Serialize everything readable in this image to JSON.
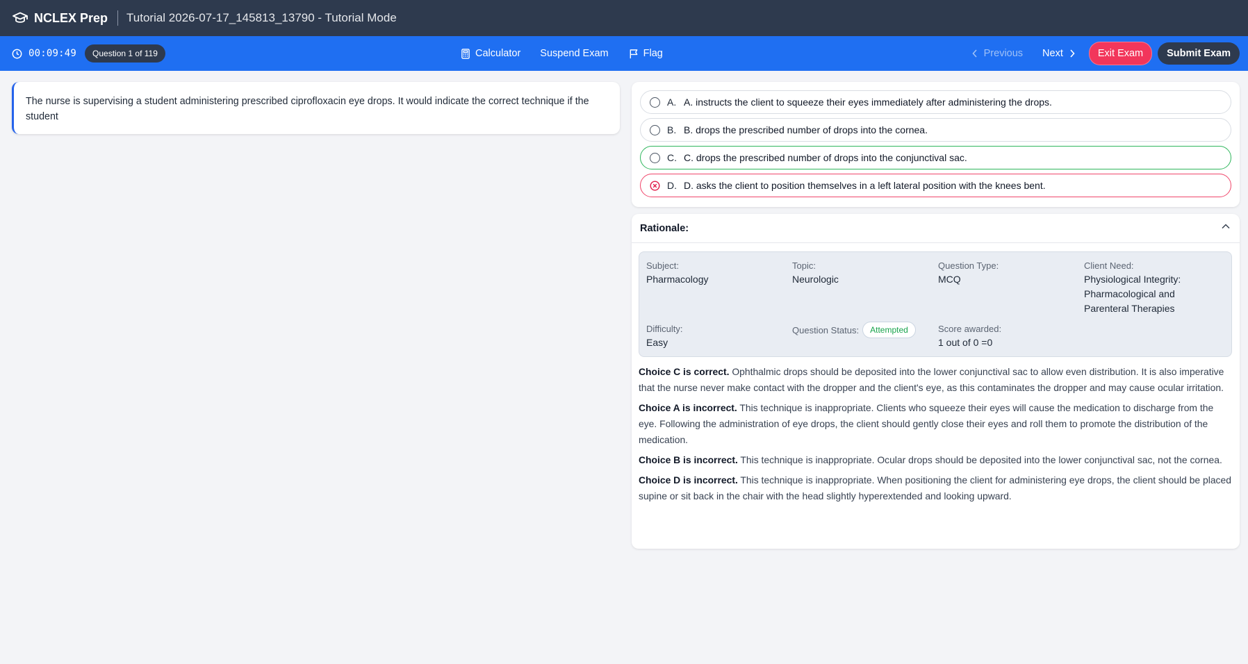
{
  "header": {
    "app_title": "NCLEX Prep",
    "exam_title": "Tutorial 2026-07-17_145813_13790 - Tutorial Mode"
  },
  "toolbar": {
    "timer": "00:09:49",
    "question_counter": "Question 1 of 119",
    "calculator_label": "Calculator",
    "suspend_label": "Suspend Exam",
    "flag_label": "Flag",
    "previous_label": "Previous",
    "next_label": "Next",
    "exit_label": "Exit Exam",
    "submit_label": "Submit Exam"
  },
  "question": {
    "text": "The nurse is supervising a student administering prescribed ciprofloxacin eye drops. It would indicate the correct technique if the student"
  },
  "options": [
    {
      "letter": "A.",
      "text": "A. instructs the client to squeeze their eyes immediately after administering the drops.",
      "state": "none"
    },
    {
      "letter": "B.",
      "text": "B. drops the prescribed number of drops into the cornea.",
      "state": "none"
    },
    {
      "letter": "C.",
      "text": "C. drops the prescribed number of drops into the conjunctival sac.",
      "state": "correct"
    },
    {
      "letter": "D.",
      "text": "D. asks the client to position themselves in a left lateral position with the knees bent.",
      "state": "selected-wrong"
    }
  ],
  "rationale": {
    "title": "Rationale:",
    "subject_label": "Subject:",
    "subject_value": "Pharmacology",
    "topic_label": "Topic:",
    "topic_value": "Neurologic",
    "qtype_label": "Question Type:",
    "qtype_value": "MCQ",
    "client_need_label": "Client Need:",
    "client_need_value": "Physiological Integrity: Pharmacological and Parenteral Therapies",
    "difficulty_label": "Difficulty:",
    "difficulty_value": "Easy",
    "status_label": "Question Status:",
    "status_value": "Attempted",
    "score_label": "Score awarded:",
    "score_value": "1 out of 0 =0",
    "explanations": [
      {
        "lead": "Choice C is correct.",
        "body": " Ophthalmic drops should be deposited into the lower conjunctival sac to allow even distribution. It is also imperative that the nurse never make contact with the dropper and the client's eye, as this contaminates the dropper and may cause ocular irritation."
      },
      {
        "lead": "Choice A is incorrect.",
        "body": " This technique is inappropriate. Clients who squeeze their eyes will cause the medication to discharge from the eye. Following the administration of eye drops, the client should gently close their eyes and roll them to promote the distribution of the medication."
      },
      {
        "lead": "Choice B is incorrect.",
        "body": " This technique is inappropriate. Ocular drops should be deposited into the lower conjunctival sac, not the cornea."
      },
      {
        "lead": "Choice D is incorrect.",
        "body": " This technique is inappropriate. When positioning the client for administering eye drops, the client should be placed supine or sit back in the chair with the head slightly hyperextended and looking upward."
      }
    ]
  },
  "colors": {
    "header_bg": "#2e3a4e",
    "toolbar_bg": "#1f6ff2",
    "exit_bg": "#f2365b",
    "correct_border": "#2fb65c",
    "wrong_border": "#f0456a",
    "attempted_text": "#16a34a"
  },
  "icons": {
    "logo": "graduation-cap-icon",
    "timer": "clock-icon",
    "calculator": "calculator-icon",
    "flag": "flag-icon",
    "previous": "chevron-left-icon",
    "next": "chevron-right-icon",
    "rationale_toggle": "chevron-up-icon",
    "wrong_choice": "x-circle-icon"
  }
}
